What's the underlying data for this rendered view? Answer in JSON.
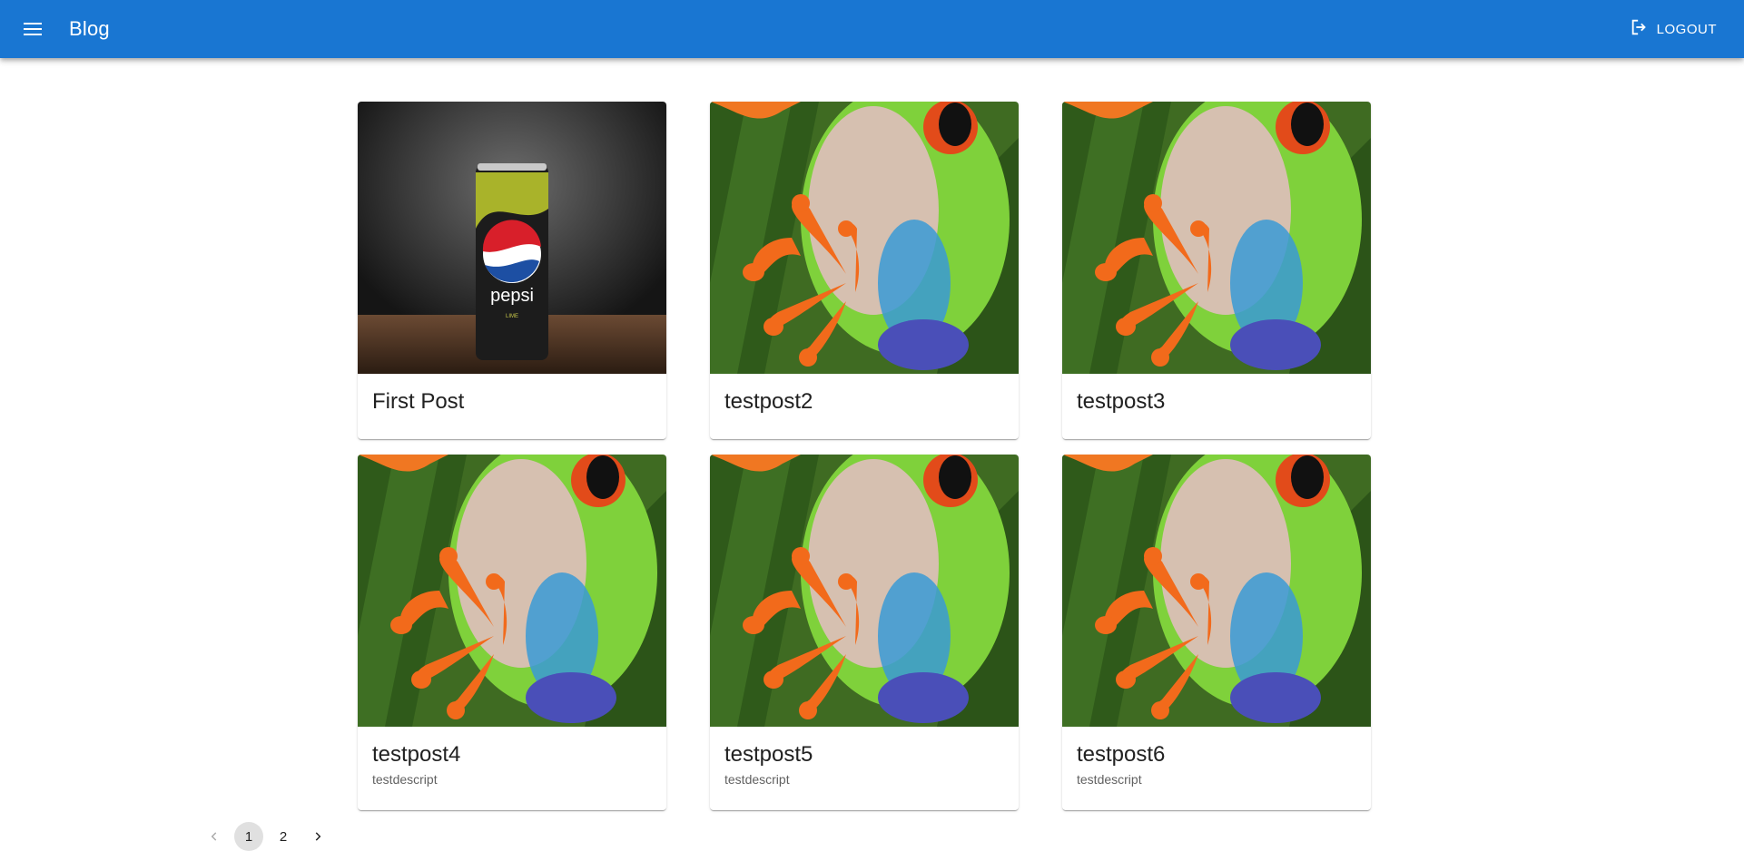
{
  "appbar": {
    "title": "Blog",
    "logout_label": "LOGOUT",
    "menu_icon": "hamburger-menu-icon",
    "logout_icon": "logout-icon",
    "color": "#1976d2"
  },
  "posts": [
    {
      "title": "First Post",
      "description": "",
      "image": "pepsi-lime-can"
    },
    {
      "title": "testpost2",
      "description": "",
      "image": "red-eyed-tree-frog"
    },
    {
      "title": "testpost3",
      "description": "",
      "image": "red-eyed-tree-frog"
    },
    {
      "title": "testpost4",
      "description": "testdescript",
      "image": "red-eyed-tree-frog"
    },
    {
      "title": "testpost5",
      "description": "testdescript",
      "image": "red-eyed-tree-frog"
    },
    {
      "title": "testpost6",
      "description": "testdescript",
      "image": "red-eyed-tree-frog"
    }
  ],
  "pagination": {
    "pages": [
      "1",
      "2"
    ],
    "current": "1"
  }
}
